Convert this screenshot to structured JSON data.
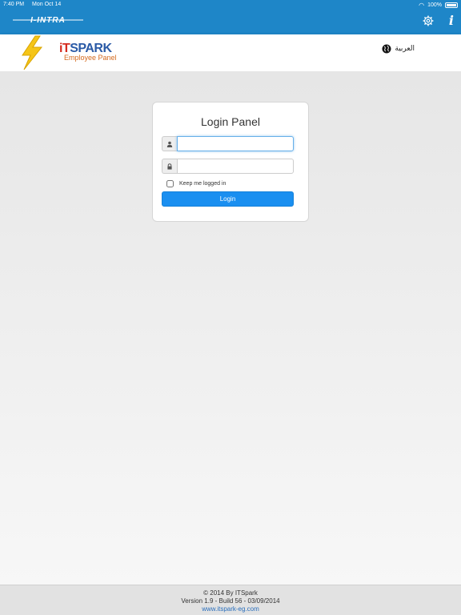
{
  "status_bar": {
    "time": "7:40 PM",
    "date": "Mon Oct 14",
    "battery": "100%"
  },
  "app_bar": {
    "brand": "I-INTRA",
    "icons": [
      "settings-icon",
      "info-icon"
    ],
    "info_glyph": "i"
  },
  "header": {
    "logo_it": "iT",
    "logo_spark": "SPARK",
    "logo_sub": "Employee Panel",
    "language_link": "العربية"
  },
  "login": {
    "title": "Login Panel",
    "username_value": "",
    "password_value": "",
    "remember_label": "Keep me logged in",
    "remember_checked": false,
    "button_label": "Login"
  },
  "footer": {
    "copyright": "© 2014 By ITSpark",
    "version": "Version 1.9 - Build 56 - 03/09/2014",
    "website": "www.itspark-eg.com"
  },
  "colors": {
    "app_bar": "#1e86c8",
    "button": "#1a8ff0",
    "logo_red": "#d52b1e",
    "logo_blue": "#2a5aa6",
    "logo_orange": "#d46a1e",
    "bolt": "#f5c518",
    "link": "#2a6ebb"
  }
}
